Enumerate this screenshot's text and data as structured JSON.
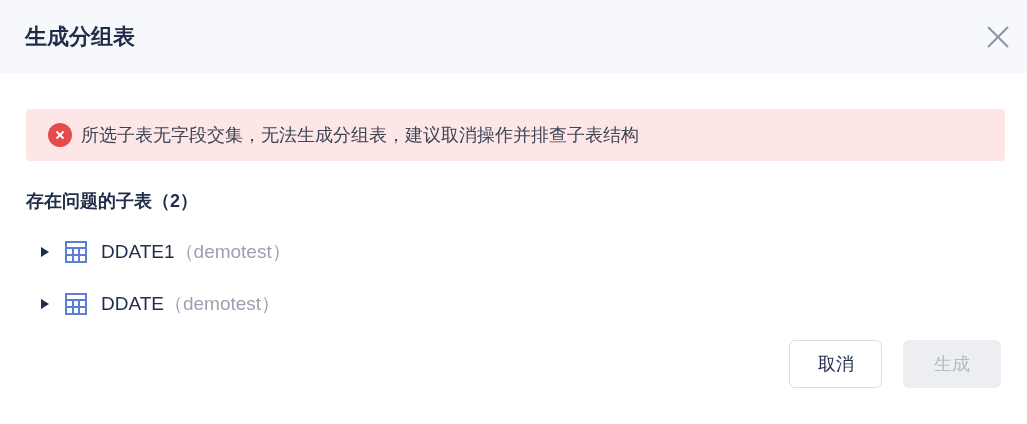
{
  "dialog": {
    "title": "生成分组表"
  },
  "alert": {
    "message": "所选子表无字段交集，无法生成分组表，建议取消操作并排查子表结构"
  },
  "section_title": "存在问题的子表（2）",
  "tables": [
    {
      "name": "DDATE1",
      "schema": "（demotest）",
      "expanded": false
    },
    {
      "name": "DDATE",
      "schema": "（demotest）",
      "expanded": false
    }
  ],
  "buttons": [
    {
      "label": "取消",
      "disabled": false
    },
    {
      "label": "生成",
      "disabled": true
    }
  ]
}
